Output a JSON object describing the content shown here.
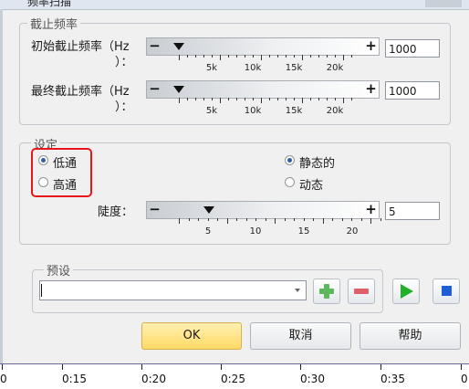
{
  "window": {
    "title": "频率扫描"
  },
  "cutoff_group": {
    "legend": "截止频率",
    "start_label_1": "初始截止频率（Hz",
    "start_label_2": "）：",
    "end_label_1": "最终截止频率（Hz",
    "end_label_2": "）：",
    "start_value": "1000",
    "end_value": "1000",
    "scale_labels": [
      "5k",
      "10k",
      "15k",
      "20k"
    ],
    "start_fraction": 0.02,
    "end_fraction": 0.02
  },
  "settings_group": {
    "legend": "设定",
    "radio_lowpass": "低通",
    "radio_highpass": "高通",
    "radio_static": "静态的",
    "radio_dynamic": "动态",
    "selected_pass": "低通",
    "selected_mode": "静态的",
    "slope_label": "陡度：",
    "slope_value": "5",
    "slope_scale_labels": [
      "5",
      "10",
      "15",
      "20"
    ]
  },
  "preset_group": {
    "legend": "预设",
    "preset_value": "",
    "icons": [
      "add-icon",
      "remove-icon",
      "play-icon",
      "stop-icon"
    ],
    "colors": {
      "add": "#5cb85c",
      "remove": "#e0606a",
      "play": "#22b02a",
      "stop": "#1f5fd6"
    }
  },
  "buttons": {
    "ok": "OK",
    "cancel": "取消",
    "help": "帮助"
  },
  "timeline": {
    "labels": [
      "0",
      "0:15",
      "0:20",
      "0:25",
      "0:30",
      "0:35",
      "0"
    ]
  },
  "slider_symbols": {
    "minus": "−",
    "plus": "+"
  }
}
